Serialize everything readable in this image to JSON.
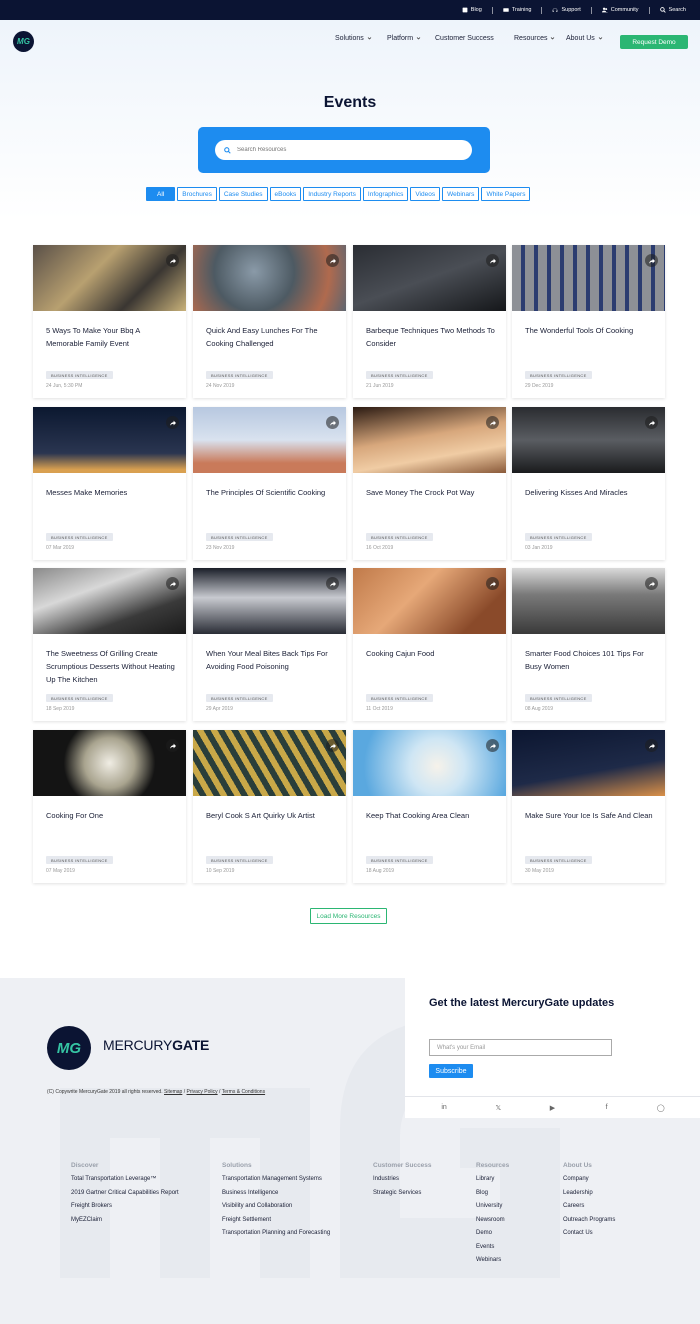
{
  "topbar": {
    "links": [
      {
        "label": "Blog",
        "icon": "blog-icon"
      },
      {
        "label": "Training",
        "icon": "training-icon"
      },
      {
        "label": "Support",
        "icon": "headset-icon"
      },
      {
        "label": "Community",
        "icon": "people-icon"
      },
      {
        "label": "Search",
        "icon": "search-icon"
      }
    ]
  },
  "header": {
    "logo": "MG",
    "nav": [
      {
        "label": "Solutions",
        "dropdown": true
      },
      {
        "label": "Platform",
        "dropdown": true
      },
      {
        "label": "Customer Success",
        "dropdown": false
      },
      {
        "label": "Resources",
        "dropdown": true
      },
      {
        "label": "About Us",
        "dropdown": true
      }
    ],
    "demo_label": "Request Demo"
  },
  "page": {
    "title": "Events",
    "search_placeholder": "Search Resources"
  },
  "filters": [
    "All",
    "Brochures",
    "Case Studies",
    "eBooks",
    "Industry Reports",
    "Infographics",
    "Videos",
    "Webinars",
    "White Papers"
  ],
  "cards": [
    {
      "title": "5 Ways To Make Your Bbq A Memorable Family Event",
      "tag": "BUSINESS INTELLIGENCE",
      "date": "24 Jun, 5:30 PM"
    },
    {
      "title": "Quick And Easy Lunches For The Cooking Challenged",
      "tag": "BUSINESS INTELLIGENCE",
      "date": "24 Nov 2019"
    },
    {
      "title": "Barbeque Techniques Two Methods To Consider",
      "tag": "BUSINESS INTELLIGENCE",
      "date": "21 Jun 2019"
    },
    {
      "title": "The Wonderful Tools Of Cooking",
      "tag": "BUSINESS INTELLIGENCE",
      "date": "29 Dec 2019"
    },
    {
      "title": "Messes Make Memories",
      "tag": "BUSINESS INTELLIGENCE",
      "date": "07 Mar 2019"
    },
    {
      "title": "The Principles Of Scientific Cooking",
      "tag": "BUSINESS INTELLIGENCE",
      "date": "23 Nov 2019"
    },
    {
      "title": "Save Money The Crock Pot Way",
      "tag": "BUSINESS INTELLIGENCE",
      "date": "16 Oct 2019"
    },
    {
      "title": "Delivering Kisses And Miracles",
      "tag": "BUSINESS INTELLIGENCE",
      "date": "03 Jan 2019"
    },
    {
      "title": "The Sweetness Of Grilling Create Scrumptious Desserts Without Heating Up The Kitchen",
      "tag": "BUSINESS INTELLIGENCE",
      "date": "18 Sep 2019"
    },
    {
      "title": "When Your Meal Bites Back Tips For Avoiding Food Poisoning",
      "tag": "BUSINESS INTELLIGENCE",
      "date": "29 Apr 2019"
    },
    {
      "title": "Cooking Cajun Food",
      "tag": "BUSINESS INTELLIGENCE",
      "date": "11 Oct 2019"
    },
    {
      "title": "Smarter Food Choices 101 Tips For Busy Women",
      "tag": "BUSINESS INTELLIGENCE",
      "date": "08 Aug 2019"
    },
    {
      "title": "Cooking For One",
      "tag": "BUSINESS INTELLIGENCE",
      "date": "07 May 2019"
    },
    {
      "title": "Beryl Cook S Art Quirky Uk Artist",
      "tag": "BUSINESS INTELLIGENCE",
      "date": "10 Sep 2019"
    },
    {
      "title": "Keep That Cooking Area Clean",
      "tag": "BUSINESS INTELLIGENCE",
      "date": "18 Aug 2019"
    },
    {
      "title": "Make Sure Your Ice Is Safe And Clean",
      "tag": "BUSINESS INTELLIGENCE",
      "date": "30 May 2019"
    }
  ],
  "load_more": "Load More Resources",
  "footer": {
    "brand_light": "MERCURY",
    "brand_bold": "GATE",
    "copyright": "(C) Copywrite MercuryGate 2019 all rights reserved.",
    "sitemap": "Sitemap",
    "privacy": "Privacy Policy",
    "terms": "Terms & Conditions",
    "subscribe_title": "Get the latest MercuryGate updates",
    "email_placeholder": "What's your Email",
    "subscribe_label": "Subscribe",
    "socials": [
      "linkedin-icon",
      "twitter-icon",
      "youtube-icon",
      "facebook-icon",
      "instagram-icon"
    ],
    "columns": [
      {
        "heading": "Discover",
        "links": [
          "Total Transportation Leverage™",
          "2019 Gartner Critical Capabilities Report",
          "Freight Brokers",
          "MyEZClaim"
        ]
      },
      {
        "heading": "Solutions",
        "links": [
          "Transportation Management Systems",
          "Business Intelligence",
          "Visibility and Collaboration",
          "Freight Settlement",
          "Transportation Planning and Forecasting"
        ]
      },
      {
        "heading": "Customer Success",
        "links": [
          "Industries",
          "Strategic Services"
        ]
      },
      {
        "heading": "Resources",
        "links": [
          "Library",
          "Blog",
          "University",
          "Newsroom",
          "Demo",
          "Events",
          "Webinars"
        ]
      },
      {
        "heading": "About Us",
        "links": [
          "Company",
          "Leadership",
          "Careers",
          "Outreach Programs",
          "Contact Us"
        ]
      }
    ]
  }
}
